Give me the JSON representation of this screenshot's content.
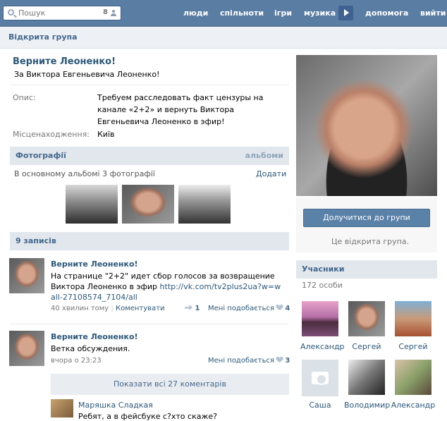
{
  "nav": {
    "search_placeholder": "Пошук",
    "search_count": "8",
    "links": [
      "люди",
      "спільноти",
      "ігри",
      "музика",
      "допомога",
      "вийти"
    ]
  },
  "page_header": "Відкрита група",
  "group": {
    "title": "Верните Леоненко!",
    "status": "За Виктора Евгеньевича Леоненко!",
    "desc_label": "Опис:",
    "desc_value": "Требуем расследовать факт цензуры на канале «2+2» и вернуть Виктора Евгеньевича Леоненко в эфир!",
    "loc_label": "Місценаходження:",
    "loc_value": "Київ"
  },
  "photos": {
    "header": "Фотографії",
    "albums_link": "альбоми",
    "summary": "В основному альбомі 3 фотографії",
    "add_link": "Додати"
  },
  "wall": {
    "header": "9 записів",
    "posts": [
      {
        "author": "Верните Леоненко!",
        "text": "На странице \"2+2\" идет сбор голосов за возвращение Виктора Леоненко в эфир",
        "link": "http://vk.com/tv2plus2ua?w=wall-27108574_7104/all",
        "time": "40 хвилин тому",
        "comment_link": "Коментувати",
        "shares": "1",
        "like_label": "Мені подобається",
        "likes": "4"
      },
      {
        "author": "Верните Леоненко!",
        "text": "Ветка обсуждения.",
        "time": "вчора о 23:23",
        "like_label": "Мені подобається",
        "likes": "3"
      }
    ],
    "show_comments": "Показати всі 27 коментарів",
    "comment": {
      "author": "Маряшка Сладкая",
      "text": "Ребят, а в фейсбуке с?хто скаже?"
    }
  },
  "sidebar": {
    "join_button": "Долучитися до групи",
    "open_note": "Це відкрита група.",
    "members_header": "Учасники",
    "members_count": "172 особи",
    "members": [
      "Александр",
      "Сергей",
      "Сергей",
      "Саша",
      "Володимир",
      "Александр"
    ]
  }
}
